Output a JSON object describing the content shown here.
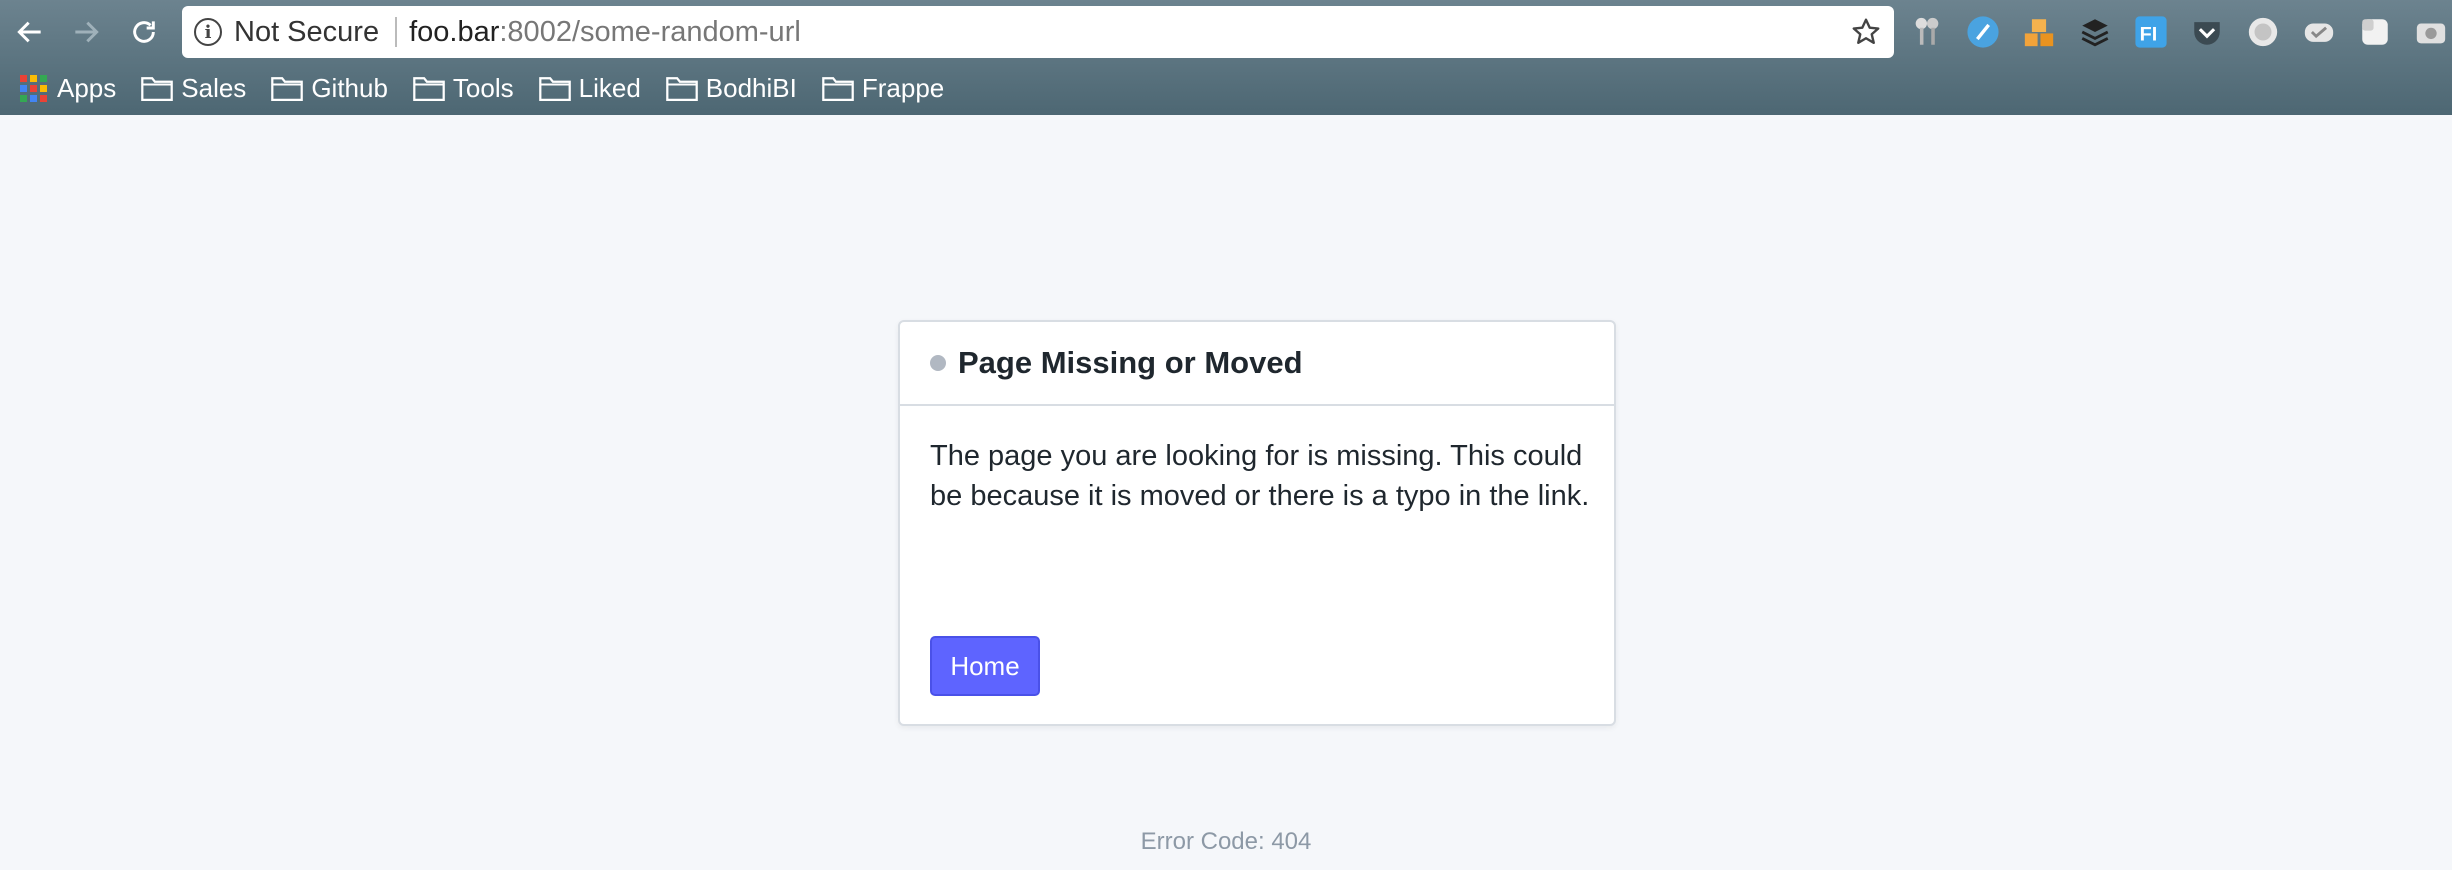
{
  "browser": {
    "security_label": "Not Secure",
    "url_host": "foo.bar",
    "url_rest": ":8002/some-random-url",
    "bookmarks": [
      {
        "label": "Apps",
        "icon": "apps-grid-icon"
      },
      {
        "label": "Sales",
        "icon": "folder-icon"
      },
      {
        "label": "Github",
        "icon": "folder-icon"
      },
      {
        "label": "Tools",
        "icon": "folder-icon"
      },
      {
        "label": "Liked",
        "icon": "folder-icon"
      },
      {
        "label": "BodhiBI",
        "icon": "folder-icon"
      },
      {
        "label": "Frappe",
        "icon": "folder-icon"
      }
    ],
    "extensions": [
      "keychain-icon",
      "plane-icon",
      "boxes-icon",
      "stack-icon",
      "fi-icon",
      "pocket-icon",
      "circle-icon",
      "check-cloud-icon",
      "square-icon",
      "camera-icon"
    ],
    "colors": {
      "chrome": "#56707c",
      "omnibox": "#ffffff"
    }
  },
  "page": {
    "card": {
      "title": "Page Missing or Moved",
      "message": "The page you are looking for is missing. This could be because it is moved or there is a typo in the link.",
      "home_button": "Home"
    },
    "error_code": "Error Code: 404",
    "colors": {
      "background": "#f5f7fa",
      "primary": "#5e64ff",
      "muted_text": "#8d99a6"
    }
  }
}
